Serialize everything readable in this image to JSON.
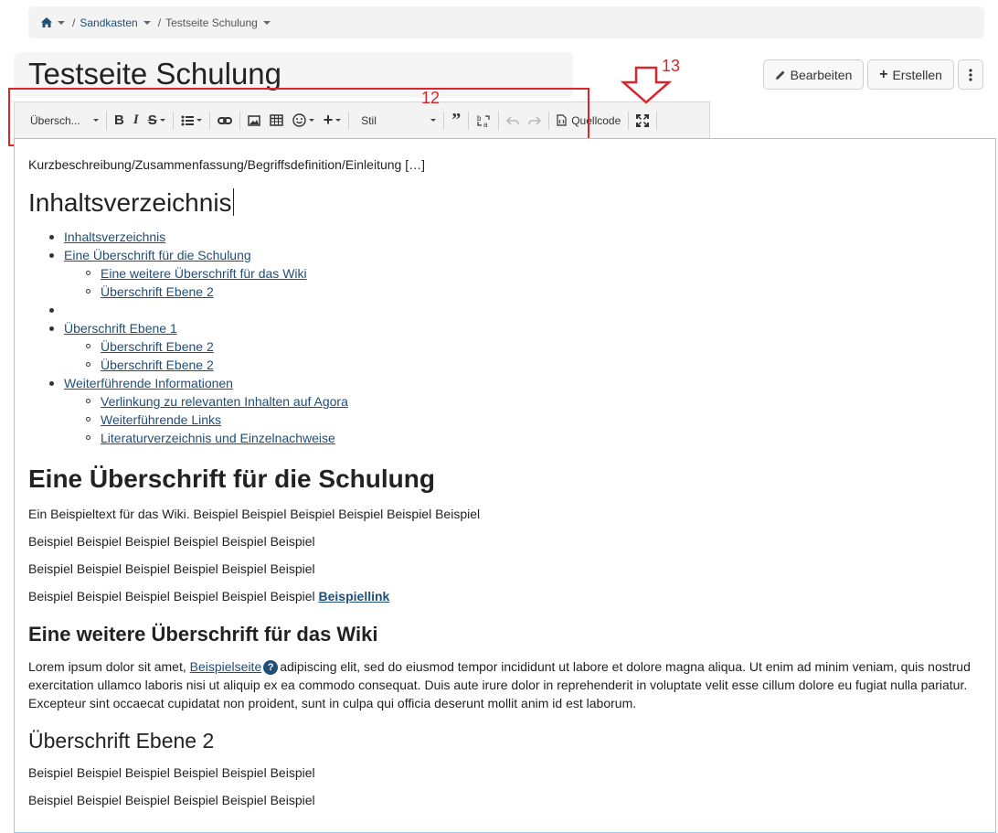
{
  "breadcrumb": {
    "items": [
      {
        "label": "Sandkasten"
      },
      {
        "label": "Testseite Schulung"
      }
    ],
    "separator": "/"
  },
  "page": {
    "title": "Testseite Schulung"
  },
  "actions": {
    "edit_label": "Bearbeiten",
    "create_label": "Erstellen"
  },
  "toolbar": {
    "format_value": "Übersch...",
    "style_value": "Stil",
    "source_label": "Quellcode",
    "icons": [
      "bold-icon",
      "italic-icon",
      "strikethrough-icon",
      "list-icon",
      "link-icon",
      "image-icon",
      "table-icon",
      "emoji-icon",
      "plus-icon",
      "quote-icon",
      "special-char-icon",
      "undo-icon",
      "redo-icon",
      "source-icon",
      "fullscreen-icon"
    ]
  },
  "annotations": {
    "toolbar_number": "12",
    "source_number": "13",
    "color": "#d9262c"
  },
  "editor": {
    "intro": "Kurzbeschreibung/Zusammenfassung/Begriffsdefinition/Einleitung […]",
    "toc_heading": "Inhaltsverzeichnis",
    "toc": {
      "i1": "Inhaltsverzeichnis",
      "i2": "Eine Überschrift für die Schulung",
      "i2a": "Eine weitere Überschrift für das Wiki",
      "i2b": "Überschrift Ebene 2",
      "i3": " ",
      "i4": "Überschrift Ebene 1",
      "i4a": "Überschrift Ebene 2",
      "i4b": "Überschrift Ebene 2",
      "i5": "Weiterführende Informationen",
      "i5a": "Verlinkung zu relevanten Inhalten auf Agora",
      "i5b": "Weiterführende Links",
      "i5c": "Literaturverzeichnis und Einzelnachweise"
    },
    "section1": {
      "heading": "Eine Überschrift für die Schulung",
      "p1": "Ein Beispieltext für das Wiki. Beispiel Beispiel Beispiel Beispiel Beispiel Beispiel",
      "p2": "Beispiel Beispiel Beispiel Beispiel Beispiel Beispiel",
      "p3": "Beispiel Beispiel Beispiel Beispiel Beispiel Beispiel",
      "p4": "Beispiel Beispiel Beispiel Beispiel Beispiel Beispiel",
      "p4_link": "Beispiellink"
    },
    "section2": {
      "heading": "Eine weitere Überschrift für das Wiki",
      "lorem_a": "Lorem ipsum dolor sit amet,",
      "lorem_link": "Beispielseite",
      "help_badge": "?",
      "lorem_b": "adipiscing elit, sed do eiusmod tempor incididunt ut labore et dolore magna aliqua. Ut enim ad minim veniam, quis nostrud",
      "lorem_c": "exercitation ullamco laboris nisi ut aliquip ex ea commodo consequat. Duis aute irure dolor in reprehenderit in voluptate velit esse cillum dolore eu fugiat nulla pariatur.",
      "lorem_d": "Excepteur sint occaecat cupidatat non proident, sunt in culpa qui officia deserunt mollit anim id est laborum."
    },
    "section3": {
      "heading": "Überschrift Ebene 2",
      "p1": "Beispiel Beispiel Beispiel Beispiel Beispiel Beispiel",
      "p2": "Beispiel Beispiel Beispiel Beispiel Beispiel Beispiel"
    }
  }
}
